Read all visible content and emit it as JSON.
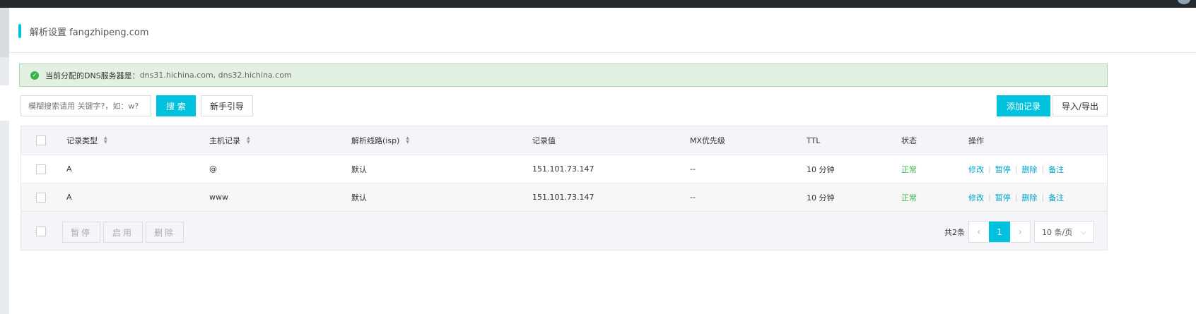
{
  "header": {
    "title": "解析设置 fangzhipeng.com"
  },
  "alert": {
    "label": "当前分配的DNS服务器是：",
    "servers": "dns31.hichina.com, dns32.hichina.com"
  },
  "toolbar": {
    "search_placeholder": "模糊搜索请用 关键字?，如：w?",
    "search_label": "搜 索",
    "guide_label": "新手引导",
    "add_label": "添加记录",
    "import_export_label": "导入/导出"
  },
  "table": {
    "columns": [
      "记录类型",
      "主机记录",
      "解析线路(isp)",
      "记录值",
      "MX优先级",
      "TTL",
      "状态",
      "操作"
    ],
    "rows": [
      {
        "type": "A",
        "host": "@",
        "line": "默认",
        "value": "151.101.73.147",
        "mx": "--",
        "ttl": "10 分钟",
        "status": "正常"
      },
      {
        "type": "A",
        "host": "www",
        "line": "默认",
        "value": "151.101.73.147",
        "mx": "--",
        "ttl": "10 分钟",
        "status": "正常"
      }
    ],
    "actions": [
      "修改",
      "暂停",
      "删除",
      "备注"
    ]
  },
  "footer": {
    "pause": "暂停",
    "enable": "启用",
    "delete": "删除",
    "total": "共2条",
    "page": "1",
    "page_size": "10 条/页"
  },
  "colors": {
    "accent": "#00c1de",
    "ok": "#3bb54a"
  }
}
